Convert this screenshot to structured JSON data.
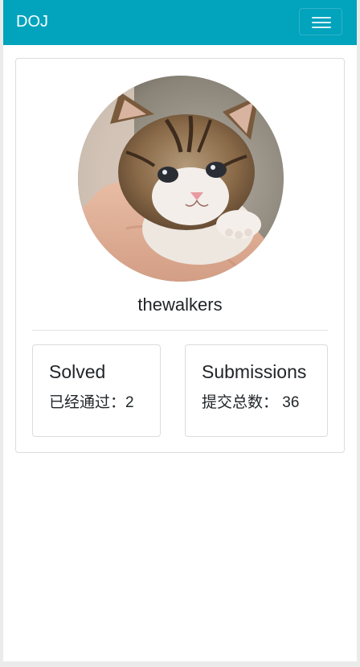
{
  "navbar": {
    "brand": "DOJ",
    "menu_icon": "hamburger-menu-icon",
    "background_color": "#02a3bd"
  },
  "profile": {
    "avatar_description": "kitten-photo",
    "username": "thewalkers"
  },
  "stats": [
    {
      "title": "Solved",
      "value_text": "已经通过：2"
    },
    {
      "title": "Submissions",
      "value_text": "提交总数： 36"
    }
  ]
}
